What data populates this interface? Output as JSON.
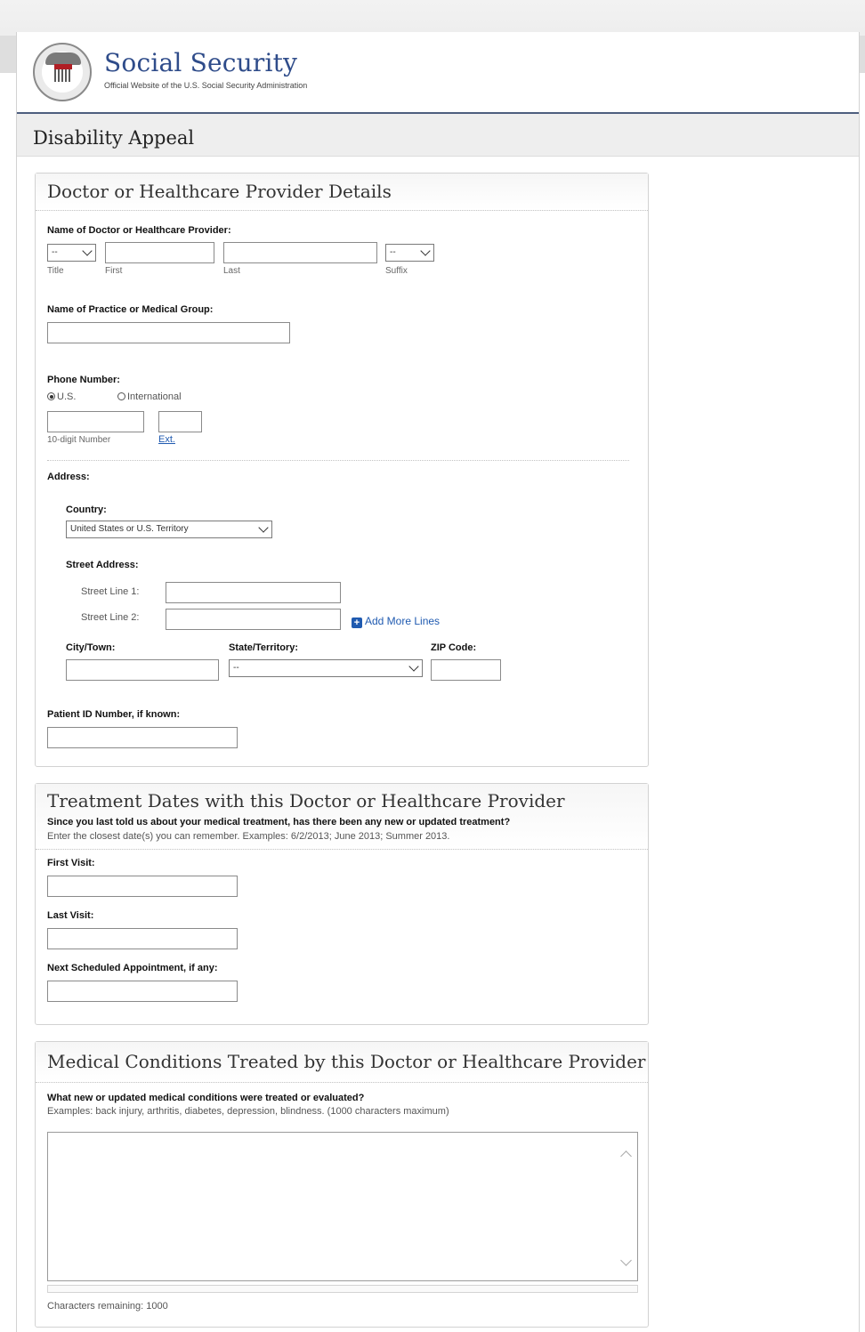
{
  "header": {
    "brand_title": "Social Security",
    "brand_subtitle": "Official Website of the U.S. Social Security Administration",
    "seal_text": "USA",
    "page_title": "Disability Appeal"
  },
  "provider": {
    "section_title": "Doctor or Healthcare Provider Details",
    "name_label": "Name of Doctor or Healthcare Provider:",
    "title_select": "--",
    "suffix_select": "--",
    "title_caption": "Title",
    "first_caption": "First",
    "last_caption": "Last",
    "suffix_caption": "Suffix",
    "practice_label": "Name of Practice or Medical Group:",
    "phone_label": "Phone Number:",
    "phone_us": "U.S.",
    "phone_intl": "International",
    "phone_number_caption": "10-digit Number",
    "phone_ext_caption": "Ext.",
    "address_label": "Address:",
    "country_label": "Country:",
    "country_value": "United States or U.S. Territory",
    "street_label": "Street Address:",
    "street_line1": "Street Line 1:",
    "street_line2": "Street Line 2:",
    "add_more_lines": "Add More Lines",
    "city_label": "City/Town:",
    "state_label": "State/Territory:",
    "state_value": "--",
    "zip_label": "ZIP Code:",
    "patient_id_label": "Patient ID Number, if known:"
  },
  "treatment": {
    "section_title": "Treatment Dates with this Doctor or Healthcare Provider",
    "question": "Since you last told us about your medical treatment, has there been any new or updated treatment?",
    "hint": "Enter the closest date(s) you can remember. Examples: 6/2/2013; June 2013; Summer 2013.",
    "first_visit": "First Visit:",
    "last_visit": "Last Visit:",
    "next_appointment": "Next Scheduled Appointment, if any:"
  },
  "conditions": {
    "section_title": "Medical Conditions Treated by this Doctor or Healthcare Provider",
    "question": "What new or updated medical conditions were treated or evaluated?",
    "hint": "Examples: back injury, arthritis, diabetes, depression, blindness.  (1000 characters maximum)",
    "chars_remaining_label": "Characters remaining:",
    "chars_remaining_value": "1000"
  }
}
